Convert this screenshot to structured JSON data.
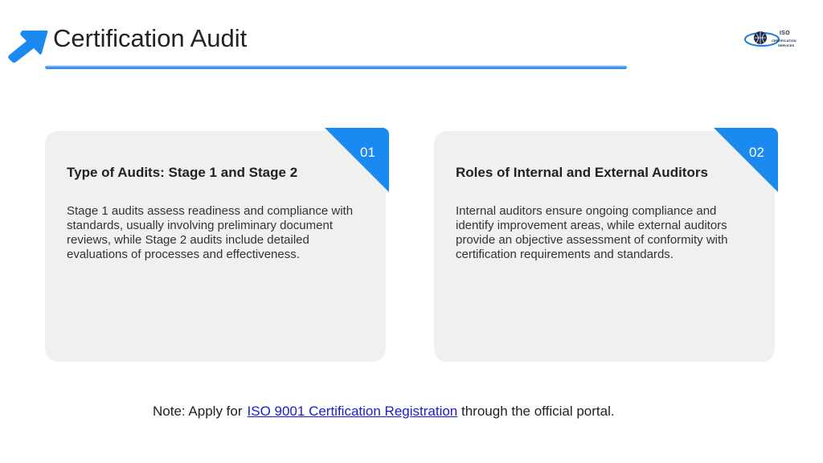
{
  "header": {
    "title": "Certification Audit",
    "arrow_icon": "arrow-up-right-icon",
    "accent_color": "#1a8af0"
  },
  "logo": {
    "line1": "ISO",
    "line2": "CERTIFICATION",
    "line3": "SERVICES"
  },
  "cards": [
    {
      "number": "01",
      "heading": "Type of Audits: Stage 1 and Stage 2",
      "body": "Stage 1 audits assess readiness and compliance with standards, usually involving preliminary document reviews, while Stage 2 audits include detailed evaluations of processes and effectiveness."
    },
    {
      "number": "02",
      "heading": "Roles of Internal and External Auditors",
      "body": "Internal auditors ensure ongoing compliance and identify improvement areas, while external auditors provide an objective assessment of conformity with certification requirements and standards."
    }
  ],
  "note": {
    "prefix": "Note: Apply for",
    "link_text": "ISO 9001 Certification Registration",
    "suffix": " through the official portal."
  },
  "colors": {
    "card_bg": "#f0f0f0",
    "link": "#1a1ad6"
  }
}
